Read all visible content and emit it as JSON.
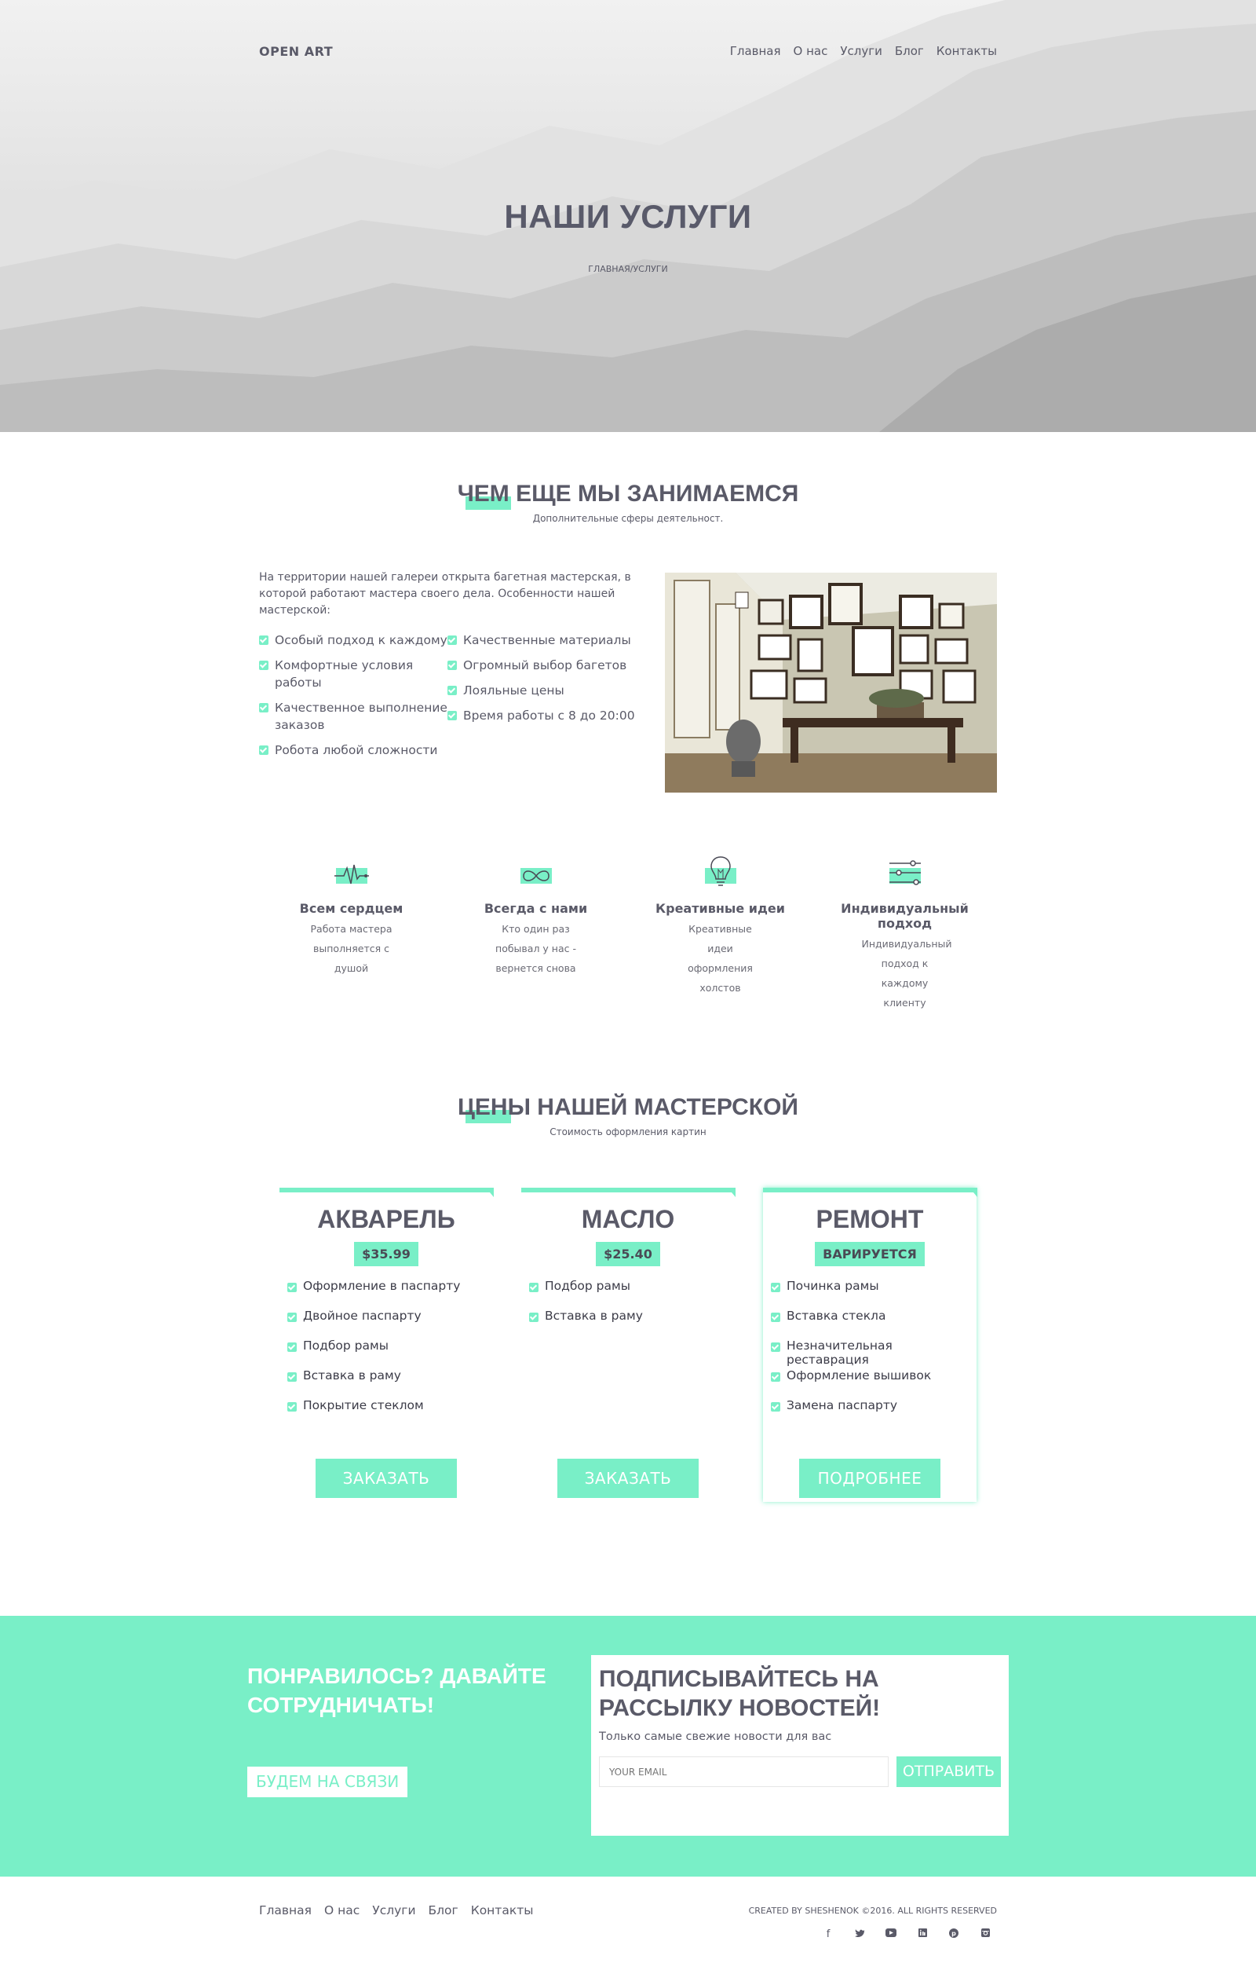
{
  "header": {
    "logo": "OPEN ART",
    "menu": [
      "Главная",
      "О нас",
      "Услуги",
      "Блог",
      "Контакты"
    ]
  },
  "hero": {
    "title": "НАШИ УСЛУГИ",
    "breadcrumb": "ГЛАВНАЯ/УСЛУГИ"
  },
  "section_more": {
    "title": "ЧЕМ ЕЩЕ МЫ ЗАНИМАЕМСЯ",
    "subtitle": "Дополнительные сферы деятельност.",
    "intro": "На территории нашей галереи открыта багетная мастерская, в которой работают мастера своего дела. Особенности нашей мастерской:",
    "features_left": [
      "Особый подход к каждому",
      "Комфортные условия работы",
      "Качественное выполнение заказов",
      "Робота любой сложности"
    ],
    "features_right": [
      "Качественные материалы",
      "Огромный выбор багетов",
      "Лояльные цены",
      "Время работы с 8 до 20:00"
    ]
  },
  "icons": [
    {
      "icon": "heartbeat-icon",
      "title": "Всем сердцем",
      "text": "Работа мастера выполняется с душой"
    },
    {
      "icon": "infinity-icon",
      "title": "Всегда с нами",
      "text": "Кто один раз побывал у нас - вернется снова"
    },
    {
      "icon": "lightbulb-icon",
      "title": "Креативные идеи",
      "text": "Креативные идеи оформления холстов"
    },
    {
      "icon": "sliders-icon",
      "title": "Индивидуальный подход",
      "text": "Индивидуальный подход к каждому клиенту"
    }
  ],
  "section_prices": {
    "title": "ЦЕНЫ НАШЕЙ МАСТЕРСКОЙ",
    "subtitle": "Стоимость оформления картин"
  },
  "cards": [
    {
      "title": "АКВАРЕЛЬ",
      "price": "$35.99",
      "items": [
        "Оформление в паспарту",
        "Двойное паспарту",
        "Подбор рамы",
        "Вставка в раму",
        "Покрытие стеклом"
      ],
      "button": "ЗАКАЗАТЬ"
    },
    {
      "title": "МАСЛО",
      "price": "$25.40",
      "items": [
        "Подбор рамы",
        "Вставка в раму"
      ],
      "button": "ЗАКАЗАТЬ"
    },
    {
      "title": "РЕМОНТ",
      "price": "ВАРИРУЕТСЯ",
      "items": [
        "Починка рамы",
        "Вставка стекла",
        "Незначительная реставрация",
        "Оформление вышивок",
        "Замена паспарту"
      ],
      "button": "ПОДРОБНЕЕ"
    }
  ],
  "cta": {
    "title": "ПОНРАВИЛОСЬ? ДАВАЙТЕ СОТРУДНИЧАТЬ!",
    "button": "БУДЕМ НА СВЯЗИ",
    "sub_title": "ПОДПИСЫВАЙТЕСЬ НА РАССЫЛКУ НОВОСТЕЙ!",
    "sub_text": "Только самые свежие новости для вас",
    "email_placeholder": "YOUR EMAIL",
    "send": "ОТПРАВИТЬ"
  },
  "footer": {
    "menu": [
      "Главная",
      "О нас",
      "Услуги",
      "Блог",
      "Контакты"
    ],
    "copyright": "CREATED BY SHESHENOK ©2016. ALL RIGHTS RESERVED",
    "social": [
      "facebook-icon",
      "twitter-icon",
      "youtube-icon",
      "linkedin-icon",
      "pinterest-icon",
      "instagram-icon"
    ]
  },
  "colors": {
    "accent": "#79efc7",
    "text": "#5a5a68"
  }
}
